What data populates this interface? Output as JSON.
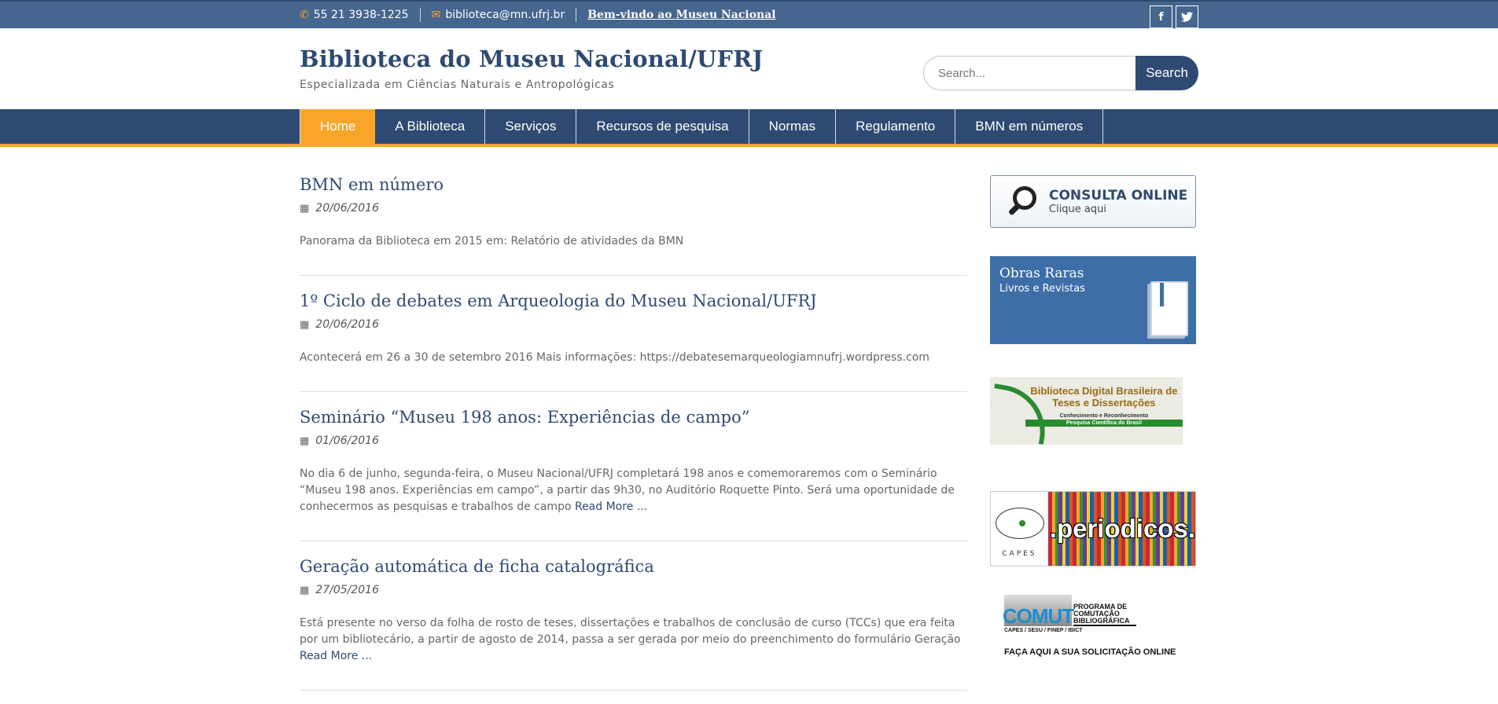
{
  "topbar": {
    "phone": "55 21 3938-1225",
    "email": "biblioteca@mn.ufrj.br",
    "welcome": "Bem-vindo ao Museu Nacional",
    "social": [
      "f",
      "t"
    ]
  },
  "header": {
    "title": "Biblioteca do Museu Nacional/UFRJ",
    "description": "Especializada em Ciências Naturais e Antropológicas",
    "search_placeholder": "Search...",
    "search_button": "Search"
  },
  "nav": {
    "tabs": [
      "Home",
      "A Biblioteca",
      "Serviços",
      "Recursos de pesquisa",
      "Normas",
      "Regulamento",
      "BMN em números"
    ],
    "active": "Home"
  },
  "posts": [
    {
      "title": "BMN em número",
      "date": "20/06/2016",
      "excerpt": "Panorama da Biblioteca em 2015 em: Relatório de atividades da BMN",
      "more": ""
    },
    {
      "title": "1º Ciclo de debates em Arqueologia do Museu Nacional/UFRJ",
      "date": "20/06/2016",
      "excerpt": "Acontecerá em 26 a 30 de setembro 2016   Mais informações: https://debatesemarqueologiamnufrj.wordpress.com",
      "more": ""
    },
    {
      "title": "Seminário “Museu 198 anos: Experiências de campo”",
      "date": "01/06/2016",
      "excerpt": "No dia 6 de junho, segunda-feira, o Museu Nacional/UFRJ completará 198 anos e comemoraremos com o Seminário  “Museu 198 anos. Experiências em campo”, a partir das 9h30, no Auditório Roquette Pinto. Será uma oportunidade de conhecermos as pesquisas e trabalhos de campo ",
      "more": "Read More ..."
    },
    {
      "title": "Geração automática de ficha catalográfica",
      "date": "27/05/2016",
      "excerpt": "Está presente no verso da folha de rosto de teses, dissertações e trabalhos de conclusão de curso (TCCs) que era feita por um bibliotecário, a partir de agosto de 2014, passa a ser gerada por meio do preenchimento do formulário Geração ",
      "more": "Read More ..."
    }
  ],
  "sidebar": {
    "consulta_title": "CONSULTA ONLINE",
    "consulta_sub": "Clique aqui",
    "obras_title": "Obras Raras",
    "obras_sub": "Livros e Revistas",
    "bdtd_title": "Biblioteca Digital Brasileira de Teses e Dissertações",
    "bdtd_tagline": "Conhecimento e Reconhecimento",
    "bdtd_bar": "Pesquisa Científica do Brasil",
    "capes_label": "CAPES",
    "periodicos": ".periodicos.",
    "comut_logo": "COMUT",
    "comut_program": "PROGRAMA DE COMUTAÇÃO BIBLIOGRÁFICA",
    "comut_sub": "CAPES / SESU / FINEP / IBICT",
    "comut_cta": "FAÇA AQUI A SUA SOLICITAÇÃO ONLINE"
  },
  "colors": {
    "primary": "#2f4a72",
    "topbar": "#46658f",
    "accent": "#f7a62a",
    "obras_bg": "#3d6ea8"
  }
}
